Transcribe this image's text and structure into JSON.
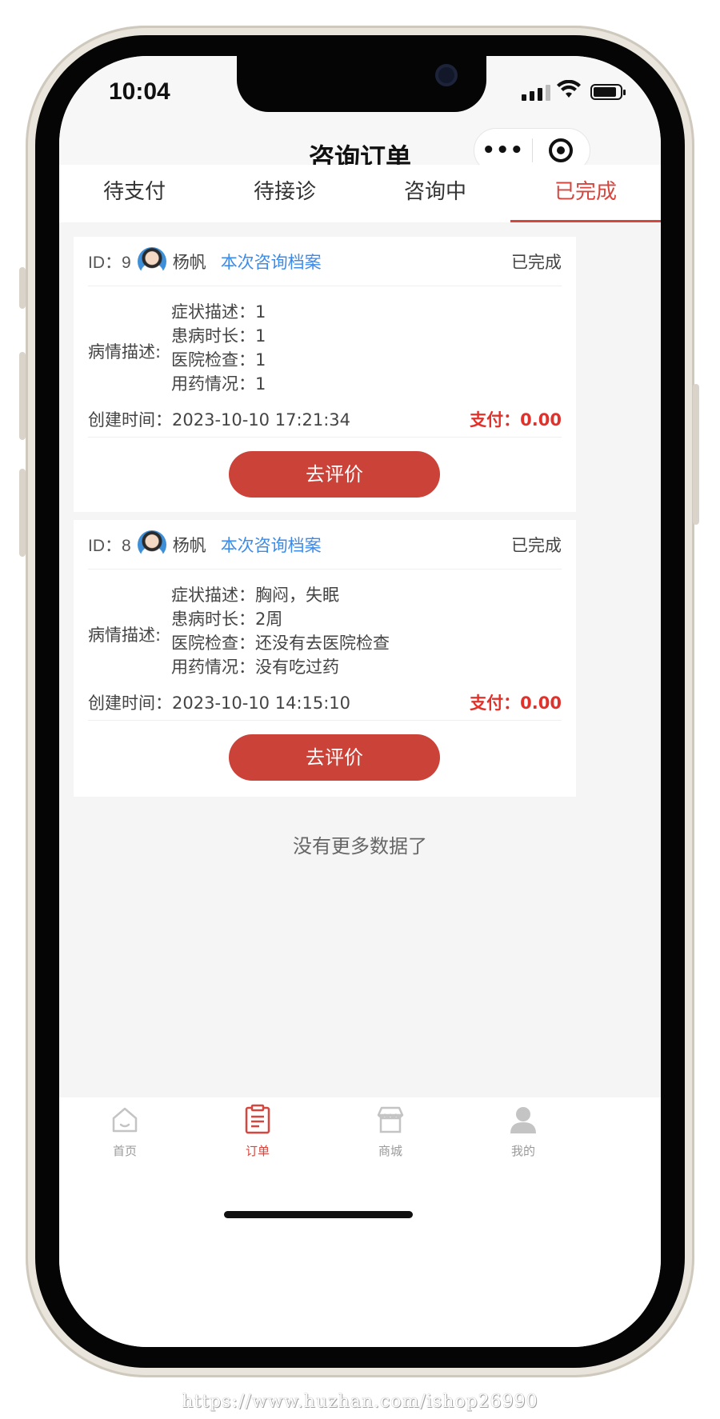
{
  "status_bar": {
    "time": "10:04"
  },
  "header": {
    "title": "咨询订单",
    "more_icon": "more-dots-icon",
    "close_icon": "target-icon"
  },
  "tabs": [
    {
      "label": "待支付",
      "active": false
    },
    {
      "label": "待接诊",
      "active": false
    },
    {
      "label": "咨询中",
      "active": false
    },
    {
      "label": "已完成",
      "active": true
    }
  ],
  "orders": [
    {
      "id_label": "ID：9",
      "doctor": "杨帆",
      "archive_link": "本次咨询档案",
      "status": "已完成",
      "condition_label": "病情描述:",
      "condition_lines": [
        "症状描述：1",
        "患病时长：1",
        "医院检查：1",
        "用药情况：1"
      ],
      "created": "创建时间：2023-10-10 17:21:34",
      "pay": "支付：0.00",
      "button": "去评价"
    },
    {
      "id_label": "ID：8",
      "doctor": "杨帆",
      "archive_link": "本次咨询档案",
      "status": "已完成",
      "condition_label": "病情描述:",
      "condition_lines": [
        "症状描述：胸闷，失眠",
        "患病时长：2周",
        "医院检查：还没有去医院检查",
        "用药情况：没有吃过药"
      ],
      "created": "创建时间：2023-10-10 14:15:10",
      "pay": "支付：0.00",
      "button": "去评价"
    }
  ],
  "no_more": "没有更多数据了",
  "tabbar": [
    {
      "label": "首页",
      "icon": "home-icon",
      "active": false
    },
    {
      "label": "订单",
      "icon": "order-icon",
      "active": true
    },
    {
      "label": "商城",
      "icon": "shop-icon",
      "active": false
    },
    {
      "label": "我的",
      "icon": "profile-icon",
      "active": false
    }
  ],
  "colors": {
    "accent": "#d5463e",
    "link": "#3d8be8",
    "button": "#cb4239"
  },
  "watermark": "https://www.huzhan.com/ishop26990"
}
